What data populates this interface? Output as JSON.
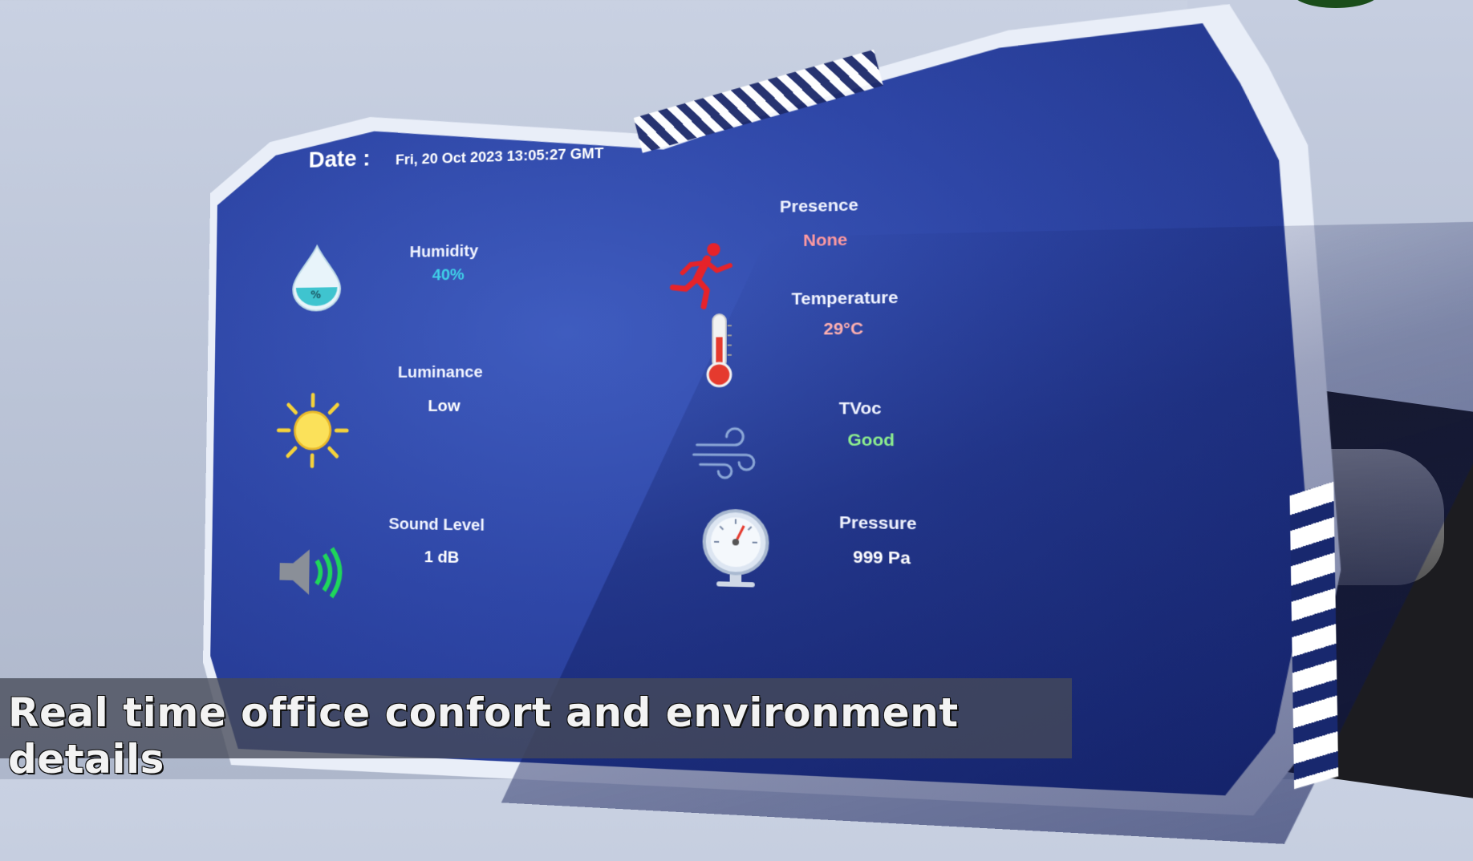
{
  "panel": {
    "date_label": "Date :",
    "date_value": "Fri, 20 Oct 2023 13:05:27 GMT"
  },
  "metrics": {
    "humidity": {
      "label": "Humidity",
      "value": "40%",
      "icon": "water-drop-icon",
      "value_color": "#3fd0e8"
    },
    "luminance": {
      "label": "Luminance",
      "value": "Low",
      "icon": "sun-icon",
      "value_color": "#ffffff"
    },
    "sound": {
      "label": "Sound Level",
      "value": "1 dB",
      "icon": "speaker-icon",
      "value_color": "#ffffff"
    },
    "presence": {
      "label": "Presence",
      "value": "None",
      "icon": "running-person-icon",
      "value_color": "#ff9aa0"
    },
    "temperature": {
      "label": "Temperature",
      "value": "29°C",
      "icon": "thermometer-icon",
      "value_color": "#ffb0b0"
    },
    "tvoc": {
      "label": "TVoc",
      "value": "Good",
      "icon": "wind-icon",
      "value_color": "#8ef08e"
    },
    "pressure": {
      "label": "Pressure",
      "value": "999 Pa",
      "icon": "pressure-gauge-icon",
      "value_color": "#ffffff"
    }
  },
  "caption": {
    "text": "Real time office confort and environment details"
  }
}
